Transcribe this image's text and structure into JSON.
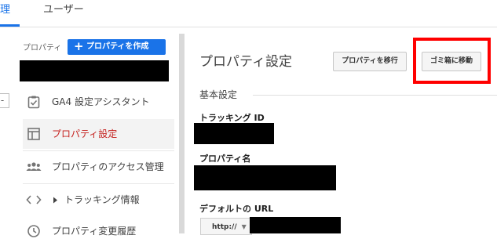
{
  "topnav": {
    "tabs": [
      {
        "label": "理"
      },
      {
        "label": "ユーザー"
      }
    ]
  },
  "sidebar": {
    "property_label": "プロパティ",
    "create_button": "プロパティを作成",
    "edge_button": "-",
    "items": [
      {
        "label": "GA4 設定アシスタント",
        "icon": "checklist-icon"
      },
      {
        "label": "プロパティ設定",
        "icon": "layout-icon",
        "active": true
      },
      {
        "label": "プロパティのアクセス管理",
        "icon": "people-icon"
      },
      {
        "label": "トラッキング情報",
        "icon": "code-icon"
      },
      {
        "label": "プロパティ変更履歴",
        "icon": "history-icon"
      }
    ]
  },
  "main": {
    "title": "プロパティ設定",
    "move_button": "プロパティを移行",
    "trash_button": "ゴミ箱に移動",
    "section_basic": "基本設定",
    "fields": {
      "tracking_id_label": "トラッキング ID",
      "property_name_label": "プロパティ名",
      "default_url_label": "デフォルトの URL",
      "protocol_value": "http://"
    }
  },
  "colors": {
    "accent": "#1a73e8",
    "active_text": "#c5221f",
    "highlight_box": "#ff0000"
  }
}
